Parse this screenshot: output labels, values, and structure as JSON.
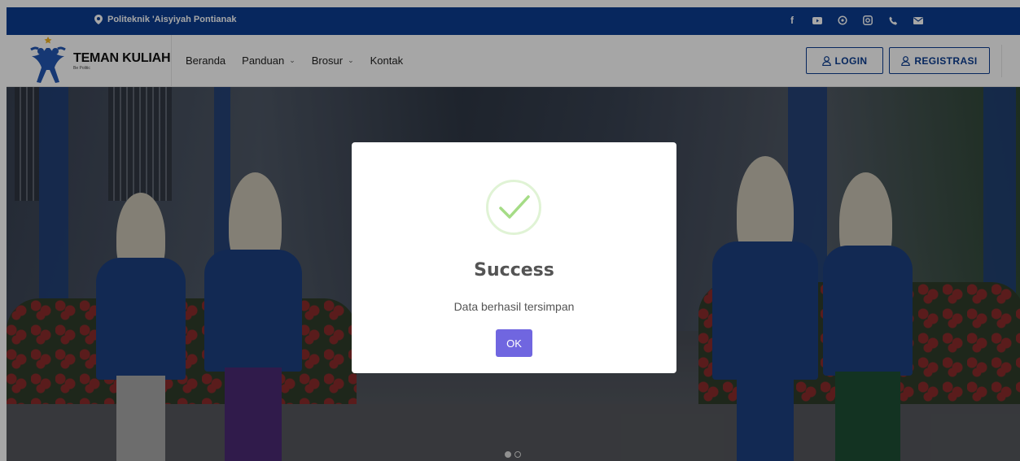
{
  "topbar": {
    "address": "Politeknik 'Aisyiyah Pontianak",
    "social_icons": [
      "facebook-icon",
      "youtube-icon",
      "whatsapp-icon",
      "instagram-icon",
      "phone-icon",
      "mail-icon"
    ]
  },
  "nav": {
    "logo_title": "TEMAN KULIAH",
    "logo_subtitle": "Be Politic",
    "menu": [
      {
        "label": "Beranda",
        "dropdown": false
      },
      {
        "label": "Panduan",
        "dropdown": true
      },
      {
        "label": "Brosur",
        "dropdown": true
      },
      {
        "label": "Kontak",
        "dropdown": false
      }
    ],
    "login_label": "LOGIN",
    "register_label": "REGISTRASI"
  },
  "carousel": {
    "slides": 2,
    "active_slide": 1
  },
  "modal": {
    "title": "Success",
    "message": "Data berhasil tersimpan",
    "ok_label": "OK"
  },
  "colors": {
    "primary_blue": "#0b3d91",
    "ok_button": "#7066e0",
    "success_green": "#a5dc86"
  }
}
